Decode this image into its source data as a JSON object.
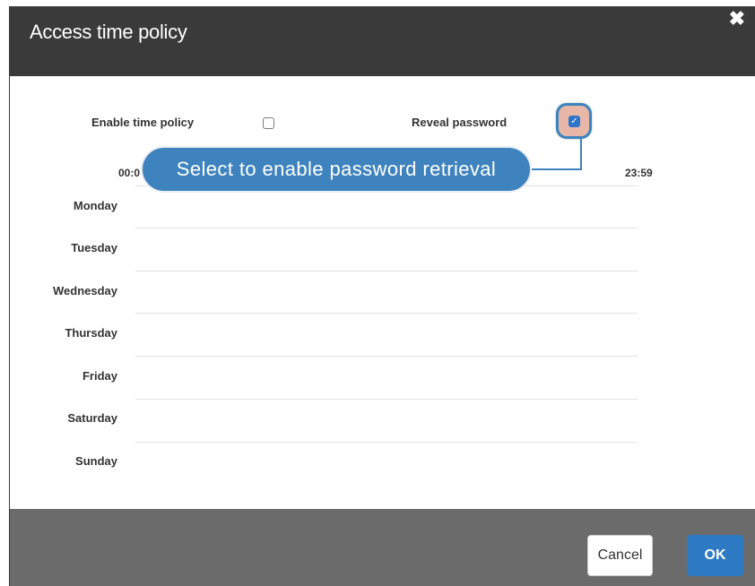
{
  "dialog": {
    "title": "Access time policy",
    "close_icon": "close-icon"
  },
  "options": {
    "enable_time_policy_label": "Enable time policy",
    "enable_time_policy_checked": false,
    "reveal_password_label": "Reveal password",
    "reveal_password_checked": true
  },
  "timeline": {
    "start": "00:00",
    "start_visible": "00:0",
    "end": "23:59"
  },
  "days": [
    "Monday",
    "Tuesday",
    "Wednesday",
    "Thursday",
    "Friday",
    "Saturday",
    "Sunday"
  ],
  "callout": {
    "text": "Select to enable password retrieval"
  },
  "footer": {
    "cancel_label": "Cancel",
    "ok_label": "OK"
  },
  "colors": {
    "header": "#3a3a3a",
    "footer": "#6b6b6b",
    "accent": "#2f7bc3",
    "callout": "#3f83be",
    "highlight": "#e8b7a8"
  }
}
